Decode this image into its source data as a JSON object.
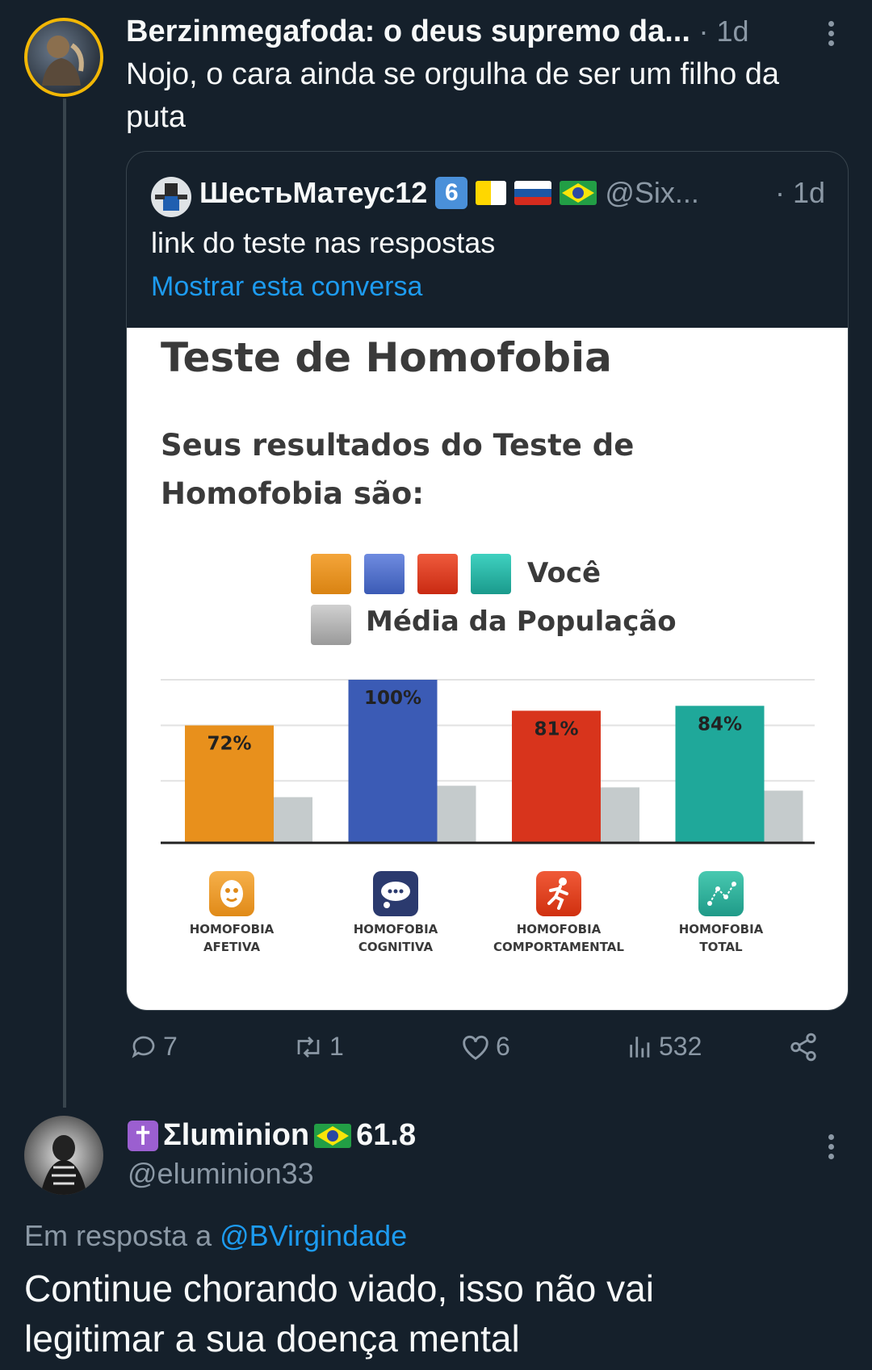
{
  "tweet1": {
    "author": "Berzinmegafoda: o deus supremo da...",
    "time": "· 1d",
    "text_line1": "Nojo, o cara ainda se orgulha de ser um filho da",
    "text_line2": "puta"
  },
  "quoted": {
    "author": "ШестьМатеус12",
    "badge": "6",
    "handle": "@Six...",
    "time": "· 1d",
    "text": "link do teste nas respostas",
    "show_thread": "Mostrar esta conversa"
  },
  "card": {
    "title": "Teste de Homofobia",
    "subtitle_line1": "Seus resultados do Teste de",
    "subtitle_line2": "Homofobia são:",
    "legend_you": "Você",
    "legend_avg": "Média da População"
  },
  "chart_data": {
    "type": "bar",
    "title": "Teste de Homofobia",
    "categories": [
      "HOMOFOBIA AFETIVA",
      "HOMOFOBIA COGNITIVA",
      "HOMOFOBIA COMPORTAMENTAL",
      "HOMOFOBIA TOTAL"
    ],
    "category_lines": [
      [
        "HOMOFOBIA",
        "AFETIVA"
      ],
      [
        "HOMOFOBIA",
        "COGNITIVA"
      ],
      [
        "HOMOFOBIA",
        "COMPORTAMENTAL"
      ],
      [
        "HOMOFOBIA",
        "TOTAL"
      ]
    ],
    "series": [
      {
        "name": "Você",
        "values": [
          72,
          100,
          81,
          84
        ],
        "labels": [
          "72%",
          "100%",
          "81%",
          "84%"
        ],
        "colors": [
          "#e8901c",
          "#3b5bb5",
          "#d8341c",
          "#1fa89a"
        ]
      },
      {
        "name": "Média da População",
        "values": [
          28,
          35,
          34,
          32
        ],
        "color": "#c5cbcc"
      }
    ],
    "ylim": [
      0,
      100
    ],
    "grid": true,
    "legend_position": "top"
  },
  "actions": {
    "replies": "7",
    "retweets": "1",
    "likes": "6",
    "views": "532"
  },
  "tweet2": {
    "author_prefix": "✝️",
    "author": "Σluminion",
    "author_suffix": "61.8",
    "handle": "@eluminion33",
    "reply_prefix": "Em resposta a",
    "reply_to": "@BVirgindade",
    "text_line1": "Continue chorando viado, isso não vai",
    "text_line2": "legitimar a sua doença mental"
  },
  "colors": {
    "background": "#15202b",
    "link": "#1d9bf0",
    "muted": "#8b98a5"
  }
}
